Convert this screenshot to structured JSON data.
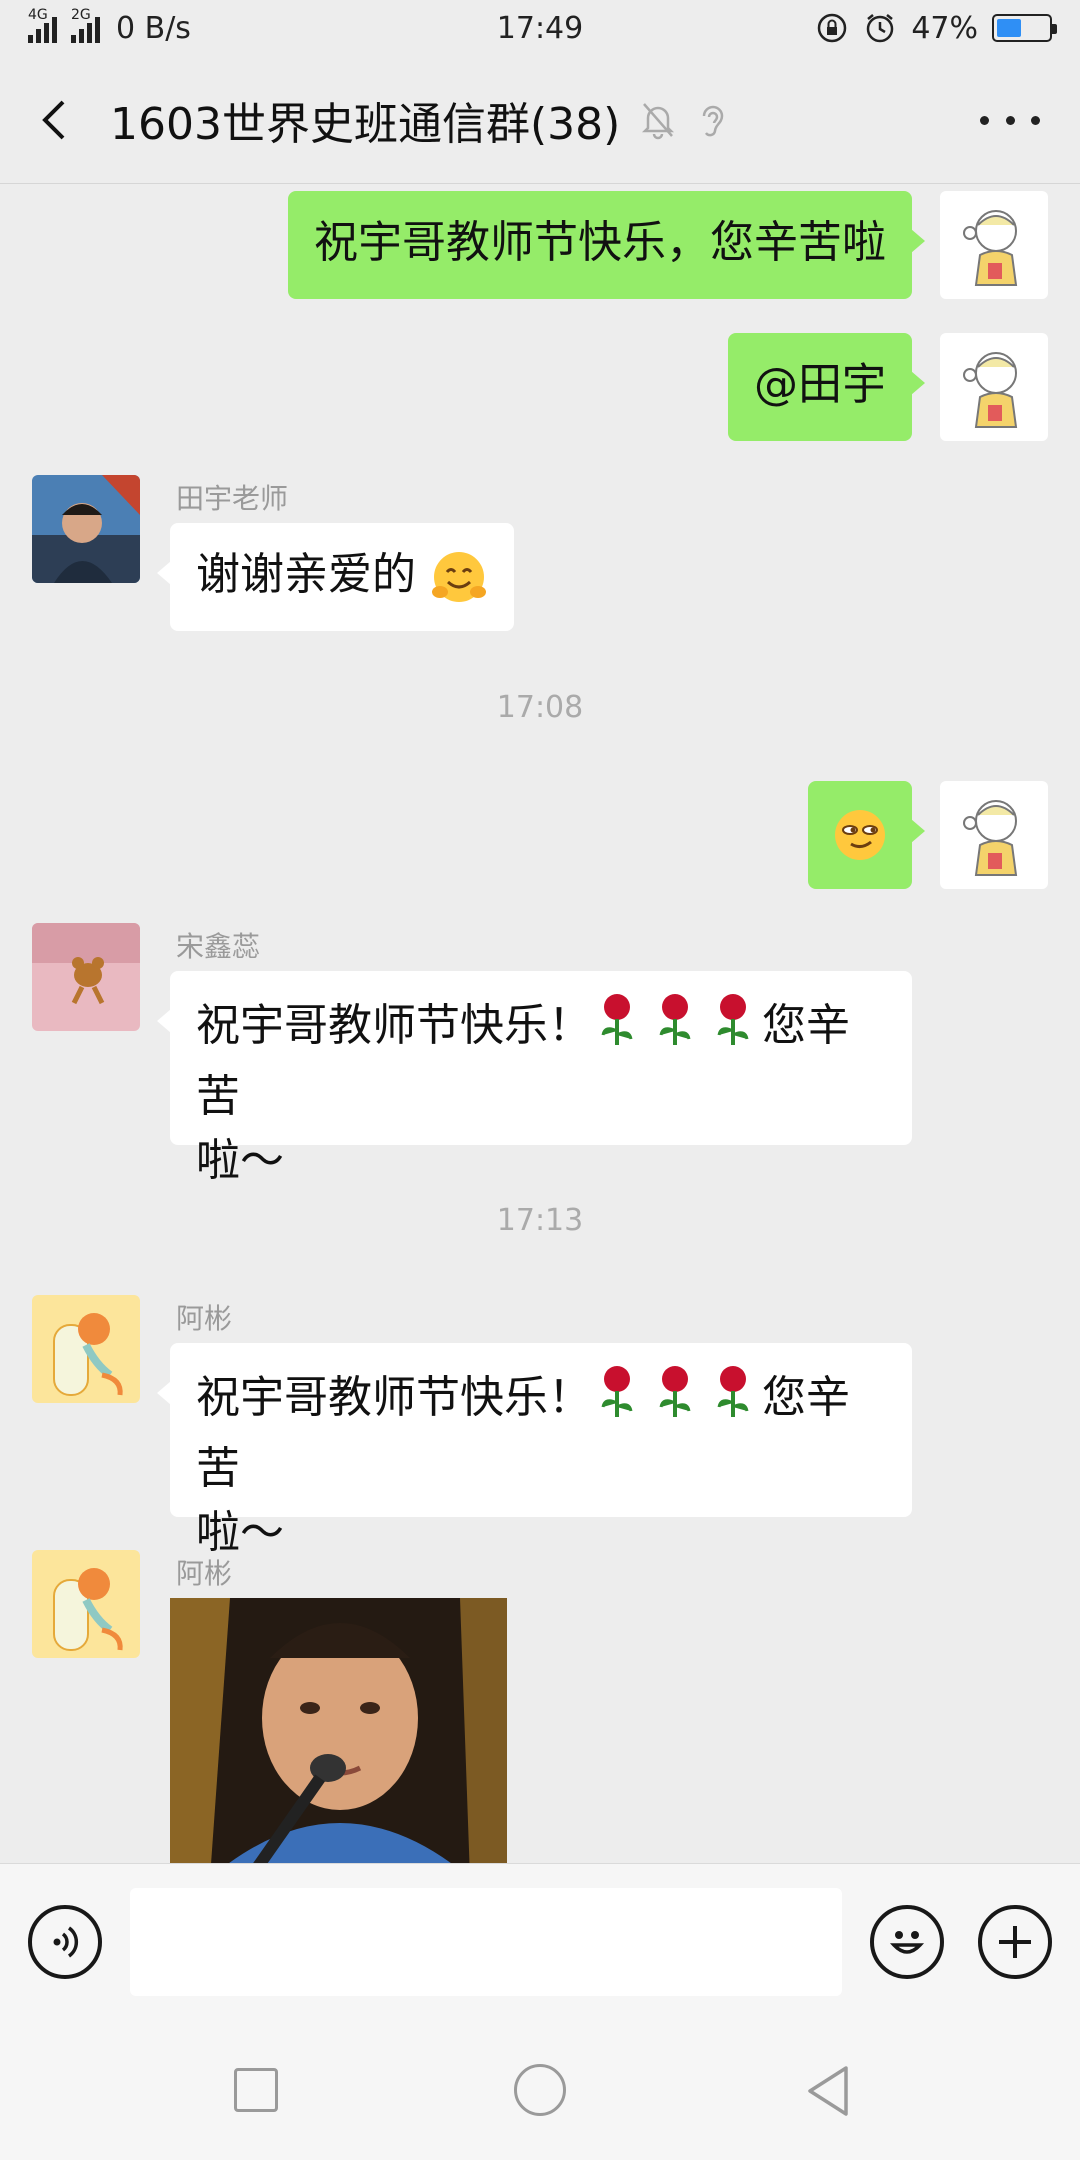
{
  "status_bar": {
    "network_1": "4G",
    "network_2": "2G",
    "speed": "0 B/s",
    "time": "17:49",
    "battery_pct": "47%",
    "battery_level": 0.47
  },
  "header": {
    "title": "1603世界史班通信群(38)"
  },
  "messages": [
    {
      "text": "祝宇哥教师节快乐，您辛苦啦"
    },
    {
      "text": "@田宇"
    },
    {
      "sender": "田宇老师",
      "text": "谢谢亲爱的"
    },
    {
      "timestamp": "17:08"
    },
    {
      "sender": "宋鑫蕊",
      "line1": "祝宇哥教师节快乐！",
      "line1_end": "您辛苦",
      "line2": "啦～"
    },
    {
      "timestamp": "17:13"
    },
    {
      "sender": "阿彬",
      "line1": "祝宇哥教师节快乐！",
      "line1_end": "您辛苦",
      "line2": "啦～"
    },
    {
      "sender": "阿彬"
    }
  ],
  "icons": {
    "back": "chevron-left-icon",
    "mute": "bell-off-icon",
    "earpiece": "ear-icon",
    "more": "more-icon",
    "voice": "voice-icon",
    "emoji": "emoji-icon",
    "add": "plus-icon"
  },
  "colors": {
    "bubble_self": "#95EC69",
    "bubble_other": "#FFFFFF",
    "background": "#EDEDED"
  }
}
